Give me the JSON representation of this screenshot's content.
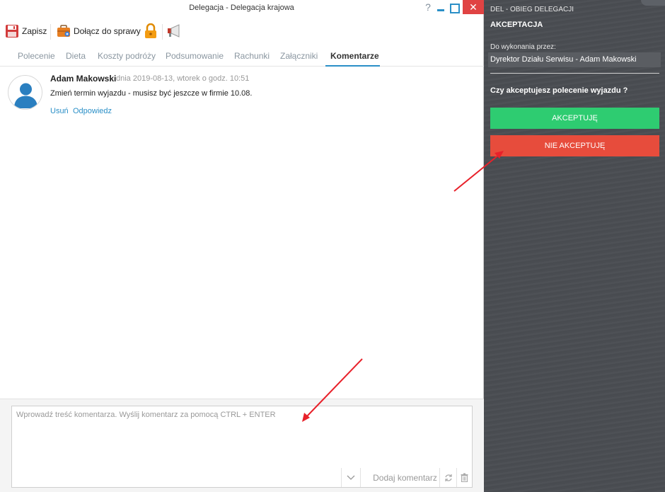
{
  "window": {
    "title": "Delegacja - Delegacja krajowa",
    "help": "?",
    "close": "✕"
  },
  "toolbar": {
    "save_label": "Zapisz",
    "attach_label": "Dołącz do sprawy"
  },
  "tabs": [
    {
      "label": "Polecenie"
    },
    {
      "label": "Dieta"
    },
    {
      "label": "Koszty podróży"
    },
    {
      "label": "Podsumowanie"
    },
    {
      "label": "Rachunki"
    },
    {
      "label": "Załączniki"
    },
    {
      "label": "Komentarze",
      "active": true
    }
  ],
  "comment": {
    "author": "Adam Makowski",
    "date": "dnia 2019-08-13, wtorek o godz. 10:51",
    "text": "Zmień termin wyjazdu - musisz być jeszcze w firmie 10.08.",
    "delete_label": "Usuń",
    "reply_label": "Odpowiedz"
  },
  "input": {
    "placeholder": "Wprowadź treść komentarza. Wyślij komentarz za pomocą CTRL + ENTER",
    "add_label": "Dodaj komentarz"
  },
  "panel": {
    "module": "DEL - OBIEG DELEGACJI",
    "title": "AKCEPTACJA",
    "assign_label": "Do wykonania przez:",
    "assignee": "Dyrektor Działu Serwisu - Adam Makowski",
    "question": "Czy akceptujesz polecenie wyjazdu ?",
    "accept_label": "AKCEPTUJĘ",
    "reject_label": "NIE AKCEPTUJĘ"
  },
  "colors": {
    "accent": "#2a8fc7",
    "accept": "#2ecc71",
    "reject": "#e74c3c",
    "panel_bg": "#4a4d52",
    "annotation_arrow": "#e8212a"
  }
}
